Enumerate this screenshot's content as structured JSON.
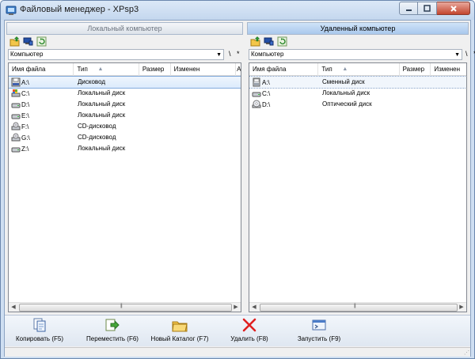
{
  "window": {
    "title": "Файловый менеджер - XPsp3",
    "accent": "#cfdff2"
  },
  "left_panel": {
    "header": "Локальный компьютер",
    "path": "Компьютер",
    "path_buttons": [
      "\\",
      "*"
    ],
    "columns": [
      "Имя файла",
      "Тип",
      "Размер",
      "Изменен",
      "А"
    ],
    "rows": [
      {
        "name": "A:\\",
        "type": "Дисковод",
        "icon": "floppy-icon"
      },
      {
        "name": "C:\\",
        "type": "Локальный диск",
        "icon": "system-drive-icon"
      },
      {
        "name": "D:\\",
        "type": "Локальный диск",
        "icon": "hard-drive-icon"
      },
      {
        "name": "E:\\",
        "type": "Локальный диск",
        "icon": "hard-drive-icon"
      },
      {
        "name": "F:\\",
        "type": "CD-дисковод",
        "icon": "cd-drive-icon"
      },
      {
        "name": "G:\\",
        "type": "CD-дисковод",
        "icon": "cd-drive-icon"
      },
      {
        "name": "Z:\\",
        "type": "Локальный диск",
        "icon": "hard-drive-icon"
      }
    ]
  },
  "right_panel": {
    "header": "Удаленный компьютер",
    "path": "Компьютер",
    "path_buttons": [
      "\\",
      "*"
    ],
    "columns": [
      "Имя файла",
      "Тип",
      "Размер",
      "Изменен"
    ],
    "rows": [
      {
        "name": "A:\\",
        "type": "Сменный диск",
        "icon": "removable-drive-icon"
      },
      {
        "name": "C:\\",
        "type": "Локальный диск",
        "icon": "hard-drive-icon"
      },
      {
        "name": "D:\\",
        "type": "Оптический диск",
        "icon": "optical-drive-icon"
      }
    ]
  },
  "actions": [
    {
      "label": "Копировать (F5)",
      "icon": "copy-icon"
    },
    {
      "label": "Переместить (F6)",
      "icon": "move-icon"
    },
    {
      "label": "Новый Каталог (F7)",
      "icon": "new-folder-icon"
    },
    {
      "label": "Удалить (F8)",
      "icon": "delete-icon"
    },
    {
      "label": "Запустить (F9)",
      "icon": "run-icon"
    }
  ]
}
